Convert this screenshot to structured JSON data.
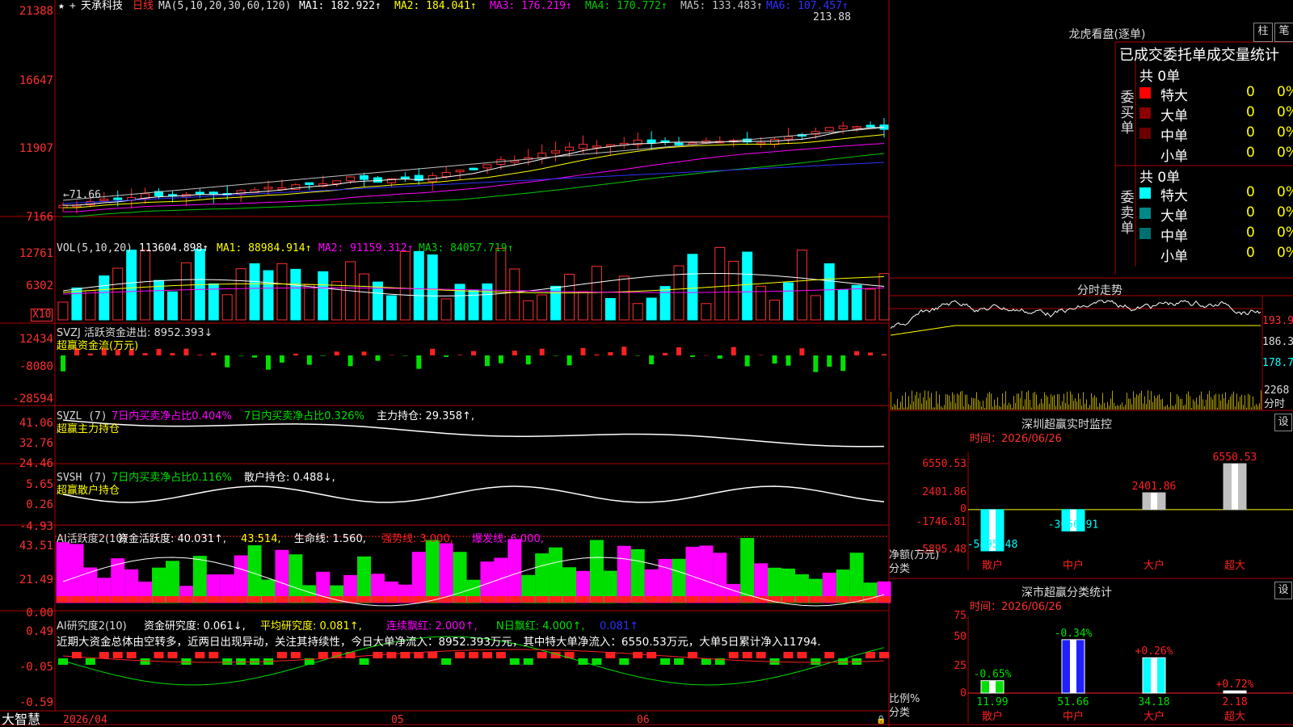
{
  "colors": {
    "up": "#ff3030",
    "down": "#00ffff",
    "ma1": "#ffffff",
    "ma2": "#ffff00",
    "ma3": "#ff00ff",
    "ma4": "#00cc00",
    "ma5": "#c0c0c0",
    "ma6": "#3030ff",
    "green": "#00e000",
    "magenta": "#ff00ff",
    "yellow": "#ffff00",
    "cyan": "#00ffff",
    "red": "#ff2020",
    "border": "#b00000"
  },
  "header": {
    "stock_name": "天承科技",
    "period": "日线",
    "ma_label": "MA(5,10,20,30,60,120)",
    "ma1": "MA1: 182.922↑",
    "ma2": "MA2: 184.041↑",
    "ma3": "MA3: 176.219↑",
    "ma4": "MA4: 170.772↑",
    "ma5": "MA5: 133.483↑",
    "ma6": "MA6: 107.457↑",
    "high_mark": "213.88",
    "low_mark": "←71.66"
  },
  "price_axis": [
    "21388",
    "16647",
    "11907",
    "7166"
  ],
  "vol": {
    "label": "VOL(5,10,20)",
    "value": "113604.898↑",
    "ma1": "MA1: 88984.914↑",
    "ma2": "MA2: 91159.312↑",
    "ma3": "MA3: 84057.719↑",
    "axis": [
      "12761",
      "6302"
    ],
    "unit": "X10"
  },
  "svzj": {
    "label": "SVZJ  活跃资金进出: 8952.393↓",
    "sub": "超赢资金流(万元)",
    "axis": [
      "12434",
      "-8080",
      "-28594"
    ]
  },
  "svzl": {
    "label": "SVZL (7)",
    "t1": "7日内买卖净占比0.404%",
    "t2": "7日内买卖净占比0.326%",
    "t3": "主力持仓: 29.358↑,",
    "sub": "超赢主力持仓",
    "axis": [
      "41.06",
      "32.76",
      "24.46"
    ]
  },
  "svsh": {
    "label": "SVSH (7)",
    "t1": "7日内买卖净占比0.116%",
    "t2": "散户持仓: 0.488↓,",
    "sub": "超赢散户持仓",
    "axis": [
      "5.65",
      "0.26",
      "-4.93"
    ]
  },
  "ai1": {
    "label": "AI活跃度2(10)",
    "t1": "资金活跃度: 40.031↑,",
    "t2": "43.514,",
    "t3": "生命线: 1.560,",
    "t4": "强势线: 3.000,",
    "t5": "爆发线: 6.000,",
    "axis": [
      "43.51",
      "21.49",
      "0.00"
    ]
  },
  "ai2": {
    "label": "AI研究度2(10)",
    "t1": "资金研究度: 0.061↓,",
    "t2": "平均研究度: 0.081↑,",
    "t3": "连续飘红: 2.000↑,",
    "t4": "N日飘红: 4.000↑,",
    "t5": "0.081↑",
    "desc": "近期大资金总体由空转多，近两日出现异动，关注其持续性，今日大单净流入：8952.393万元，其中特大单净流入：6550.53万元，大单5日累计净入11794.",
    "axis": [
      "0.49",
      "-0.05",
      "-0.59"
    ]
  },
  "bottom": {
    "brand": "大智慧",
    "date": "2026/04",
    "m5": "05",
    "m6": "06"
  },
  "lhb": {
    "title": "龙虎看盘(逐单)",
    "btn1": "柱",
    "btn2": "笔",
    "tabs": "已成交委托单成交量统计",
    "buy_side": "委买单",
    "sell_side": "委卖单",
    "buy_total": "共 0单",
    "sell_total": "共 0单",
    "buy_rows": [
      {
        "label": "特大",
        "v": "0",
        "p": "0%",
        "c": "#ff0000"
      },
      {
        "label": "大单",
        "v": "0",
        "p": "0%",
        "c": "#8b0000"
      },
      {
        "label": "中单",
        "v": "0",
        "p": "0%",
        "c": "#6b0000"
      },
      {
        "label": "小单",
        "v": "0",
        "p": "0%",
        "c": ""
      }
    ],
    "sell_rows": [
      {
        "label": "特大",
        "v": "0",
        "p": "0%",
        "c": "#00ffff"
      },
      {
        "label": "大单",
        "v": "0",
        "p": "0%",
        "c": "#008888"
      },
      {
        "label": "中单",
        "v": "0",
        "p": "0%",
        "c": "#006f6f"
      },
      {
        "label": "小单",
        "v": "0",
        "p": "0%",
        "c": ""
      }
    ]
  },
  "fenshi": {
    "title": "分时走势",
    "axis": [
      "193.9",
      "186.3",
      "178.7"
    ],
    "vol_top": "2268",
    "vol_lab": "分时"
  },
  "sz_monitor": {
    "title": "深圳超赢实时监控",
    "btn": "设",
    "time": "时间：2026/06/26",
    "axis": [
      "6550.53",
      "2401.86",
      "0",
      "-1746.81",
      "-5895.48"
    ],
    "unit": "净额(万元)",
    "cat_lab": "分类"
  },
  "sz_stats": {
    "title": "深市超赢分类统计",
    "btn": "设",
    "time": "时间：2026/06/26",
    "axis": [
      "75",
      "50",
      "25",
      "0"
    ],
    "unit": "比例%",
    "cat_lab": "分类"
  },
  "chart_data": [
    {
      "type": "bar",
      "title": "深圳超赢实时监控",
      "categories": [
        "散户",
        "中户",
        "大户",
        "超大"
      ],
      "values": [
        -5895.48,
        -3056.91,
        2401.86,
        6550.53
      ],
      "ylabel": "净额(万元)",
      "ylim": [
        -5895.48,
        6550.53
      ]
    },
    {
      "type": "bar",
      "title": "深市超赢分类统计",
      "categories": [
        "散户",
        "中户",
        "大户",
        "超大"
      ],
      "series": [
        {
          "values": [
            11.99,
            51.66,
            34.18,
            2.18
          ]
        }
      ],
      "changes": [
        "-0.65%",
        "-0.34%",
        "+0.26%",
        "+0.72%"
      ],
      "ylabel": "比例%",
      "ylim": [
        0,
        75
      ]
    }
  ]
}
